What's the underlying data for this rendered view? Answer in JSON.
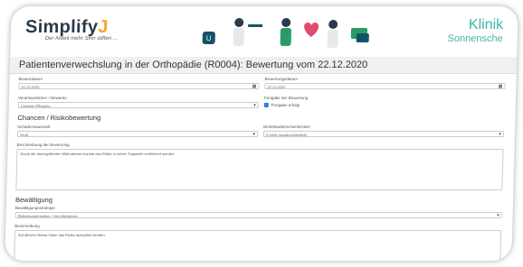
{
  "header": {
    "logo_main": "Simplify",
    "logo_j": "J",
    "logo_tagline": "Der Arbeit mehr Sinn stiften ...",
    "brand_name_1": "Klinik",
    "brand_name_2": "Sonnensche"
  },
  "title": "Patientenverwechslung in der Orthopädie (R0004): Bewertung vom 22.12.2020",
  "form": {
    "left_date_label": "Bewertdatum",
    "left_date_value": "22.12.2020",
    "right_date_label": "Bewertungsdatum",
    "right_date_value": "22.12.2020",
    "responsible_label": "Verantwortlicher / Bewerter",
    "responsible_value": "Christian Pflegerin",
    "release_label": "Freigabe der Bewertung",
    "release_checkbox_label": "Freigabe erfolgt",
    "section_chances": "Chancen / Risikobewertung",
    "severity_label": "Schadensausmaß",
    "severity_value": "Groß",
    "probability_label": "Eintrittswahrscheinlichkeit",
    "probability_value": "0 (sehr unwahrscheinlich)",
    "description_label": "Beschreibung der Bewertung",
    "description_value": "Durch die durchgeführten Maßnahmen konnte das Risiko in seiner Tragweite verkleinert werden.",
    "section_handling": "Bewältigung",
    "strategy_label": "Bewältigungsstrategie",
    "strategy_value": "Risikokompensation / eine Akzeptanz",
    "note_label": "Beschreibung",
    "note_value": "Auf diesem Niveau kann das Risiko akzeptiert werden."
  },
  "icons": {
    "calendar": "calendar-icon",
    "dropdown": "chevron-down-icon"
  },
  "colors": {
    "brand_teal": "#3fb5a6",
    "logo_dark": "#2b3a4a",
    "logo_accent": "#f5a623",
    "checkbox_blue": "#2f7de1"
  }
}
